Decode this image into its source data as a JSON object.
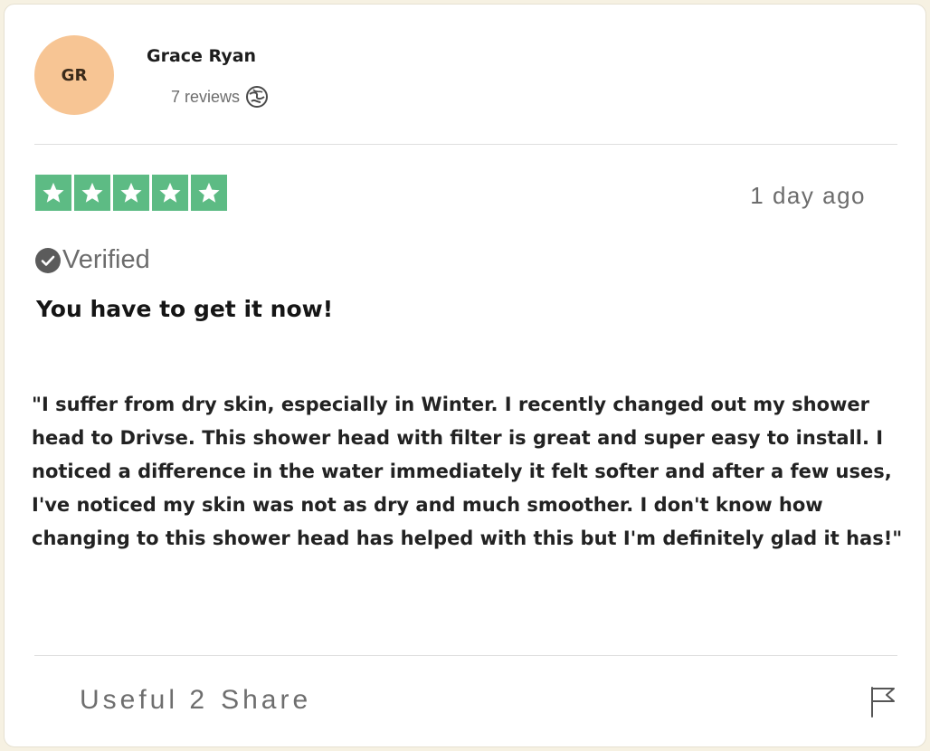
{
  "author": {
    "initials": "GR",
    "name": "Grace Ryan",
    "reviews_label": "7 reviews",
    "reviews_icon": "globe-icon"
  },
  "rating": {
    "stars": 5,
    "max": 5,
    "color": "#5dbb84"
  },
  "date": "1 day ago",
  "verified": {
    "label": "Verified",
    "icon": "check-circle-icon"
  },
  "review": {
    "title": "You have to get it now!",
    "body": "\"I suffer from dry skin, especially in  Winter. I recently changed out my shower head to Drivse. This shower head with filter is great and super easy to install. I noticed a difference in the water immediately it felt softer and after a few uses, I've noticed my skin was not as dry and much smoother. I don't know how changing to this shower head has helped with this but I'm definitely glad it has!\""
  },
  "actions": {
    "useful_label": "Useful",
    "useful_count": "2",
    "share_label": "Share",
    "report_icon": "flag-icon"
  },
  "colors": {
    "avatar_bg": "#f7c594",
    "star_green": "#5dbb84"
  }
}
